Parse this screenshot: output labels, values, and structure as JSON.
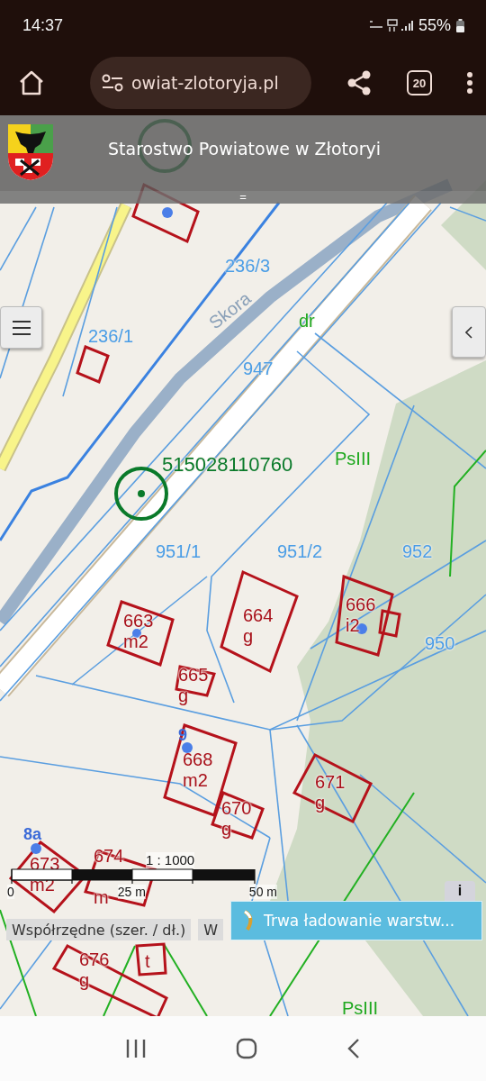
{
  "status_bar": {
    "time": "14:37",
    "battery": "55%"
  },
  "browser": {
    "url": "owiat-zlotoryja.pl",
    "tab_count": "20"
  },
  "header": {
    "title": "Starostwo Powiatowe w Złotoryi",
    "handle": "="
  },
  "map": {
    "labels": [
      {
        "text": "236/3",
        "kind": "parcel"
      },
      {
        "text": "Skora",
        "kind": "street"
      },
      {
        "text": "dr",
        "kind": "land_class"
      },
      {
        "text": "236/1",
        "kind": "parcel"
      },
      {
        "text": "947",
        "kind": "parcel"
      },
      {
        "text": "515028110760",
        "kind": "point_id"
      },
      {
        "text": "PsIII",
        "kind": "land_class"
      },
      {
        "text": "951/1",
        "kind": "parcel"
      },
      {
        "text": "951/2",
        "kind": "parcel"
      },
      {
        "text": "952",
        "kind": "parcel"
      },
      {
        "text": "950",
        "kind": "parcel"
      },
      {
        "text": "PsIII",
        "kind": "land_class"
      }
    ],
    "buildings": [
      {
        "number": "663",
        "use": "m2"
      },
      {
        "number": "664",
        "use": "g"
      },
      {
        "number": "666",
        "use": "i2"
      },
      {
        "number": "665",
        "use": "g"
      },
      {
        "number": "668",
        "use": "m2"
      },
      {
        "number": "670",
        "use": "g"
      },
      {
        "number": "671",
        "use": "g"
      },
      {
        "number": "673",
        "use": "m2"
      },
      {
        "number": "674",
        "use": "m"
      },
      {
        "number": "676",
        "use": "g"
      },
      {
        "use": "t"
      }
    ],
    "addresses": [
      "9",
      "8a"
    ]
  },
  "scale": {
    "ratio": "1 : 1000",
    "ticks": [
      "0",
      "25 m",
      "50 m"
    ]
  },
  "buttons": [
    "Współrzędne (szer. / dł.)",
    "W"
  ],
  "toast": {
    "text": "Trwa ładowanie warstw..."
  },
  "info": "i"
}
